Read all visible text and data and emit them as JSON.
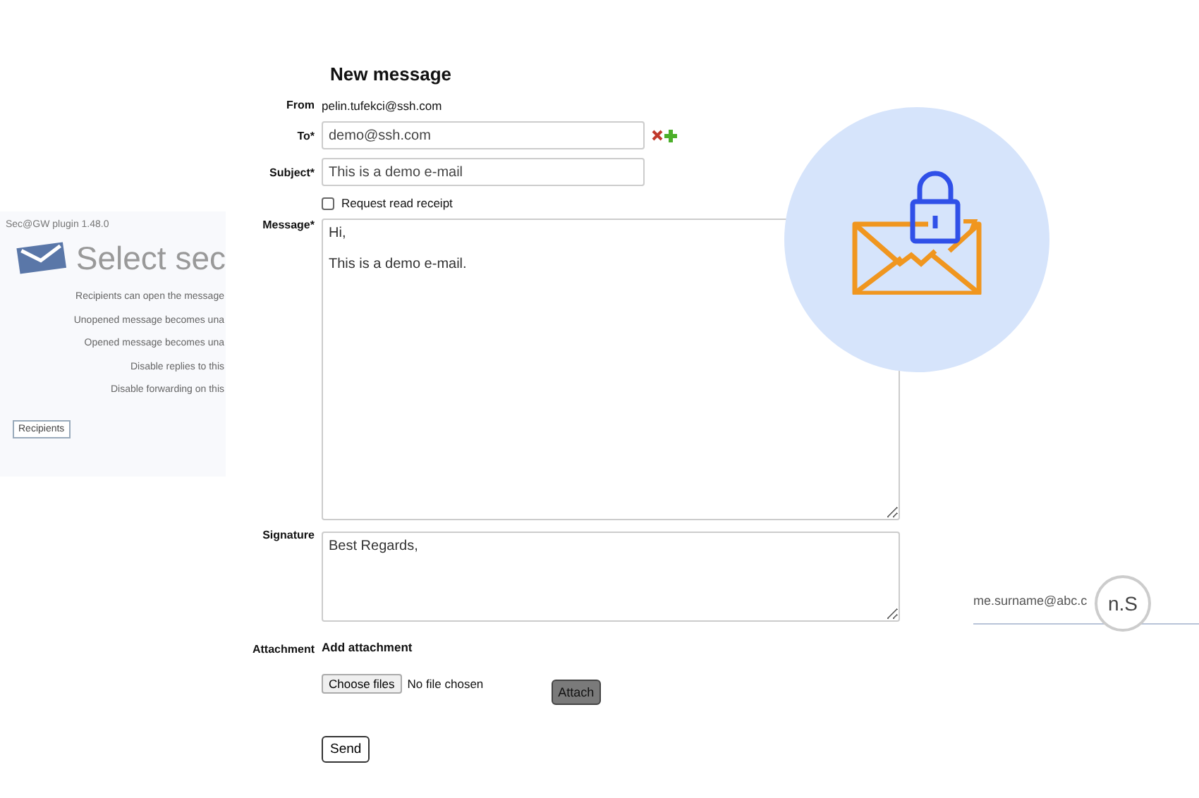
{
  "title": "New message",
  "from": {
    "label": "From",
    "value": "pelin.tufekci@ssh.com"
  },
  "to": {
    "label": "To*",
    "value": "demo@ssh.com"
  },
  "subject": {
    "label": "Subject*",
    "value": "This is a demo e-mail"
  },
  "read_receipt": {
    "label": "Request read receipt",
    "checked": false
  },
  "message": {
    "label": "Message*",
    "value": "Hi,\n\nThis is a demo e-mail."
  },
  "signature": {
    "label": "Signature",
    "value": "Best Regards,"
  },
  "attachment": {
    "label": "Attachment",
    "heading": "Add attachment",
    "choose_button": "Choose files",
    "status": "No file chosen",
    "attach_button": "Attach"
  },
  "send_button": "Send",
  "plugin_panel": {
    "version": "Sec@GW plugin 1.48.0",
    "heading": "Select sec",
    "options": [
      "Recipients can open the message",
      "Unopened message becomes una",
      "Opened message becomes una",
      "Disable replies to this",
      "Disable forwarding on this"
    ],
    "button": "Recipients"
  },
  "address_snippet": {
    "value": "me.surname@abc.c",
    "magnified": "n.S"
  }
}
